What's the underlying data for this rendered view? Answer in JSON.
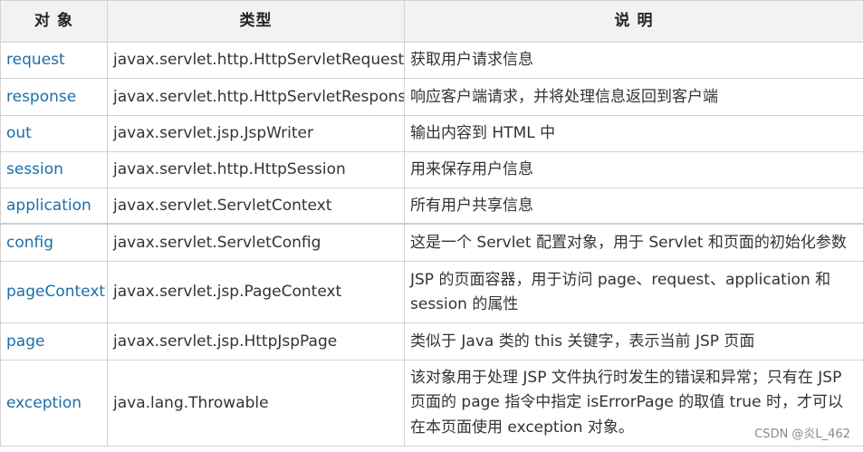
{
  "table": {
    "headers": [
      "对 象",
      "类型",
      "说 明"
    ],
    "rows": [
      {
        "name": "request",
        "type": "javax.servlet.http.HttpServletRequest",
        "desc": "获取用户请求信息"
      },
      {
        "name": "response",
        "type": "javax.servlet.http.HttpServletResponse",
        "desc": "响应客户端请求，并将处理信息返回到客户端"
      },
      {
        "name": "out",
        "type": "javax.servlet.jsp.JspWriter",
        "desc": "输出内容到 HTML 中"
      },
      {
        "name": "session",
        "type": "javax.servlet.http.HttpSession",
        "desc": "用来保存用户信息"
      },
      {
        "name": "application",
        "type": "javax.servlet.ServletContext",
        "desc": "所有用户共享信息"
      },
      {
        "name": "config",
        "type": "javax.servlet.ServletConfig",
        "desc": "这是一个 Servlet 配置对象，用于 Servlet 和页面的初始化参数"
      },
      {
        "name": "pageContext",
        "type": "javax.servlet.jsp.PageContext",
        "desc": "JSP 的页面容器，用于访问 page、request、application 和 session 的属性"
      },
      {
        "name": "page",
        "type": "javax.servlet.jsp.HttpJspPage",
        "desc": "类似于 Java 类的 this 关键字，表示当前 JSP 页面"
      },
      {
        "name": "exception",
        "type": "java.lang.Throwable",
        "desc": "该对象用于处理 JSP 文件执行时发生的错误和异常；只有在 JSP 页面的 page 指令中指定 isErrorPage 的取值 true 时，才可以在本页面使用 exception 对象。"
      }
    ]
  },
  "watermark": "CSDN @炎L_462",
  "colors": {
    "object_name": "#1b6fa8",
    "header_bg": "#f2f2f2",
    "border": "#d2d2d2"
  }
}
